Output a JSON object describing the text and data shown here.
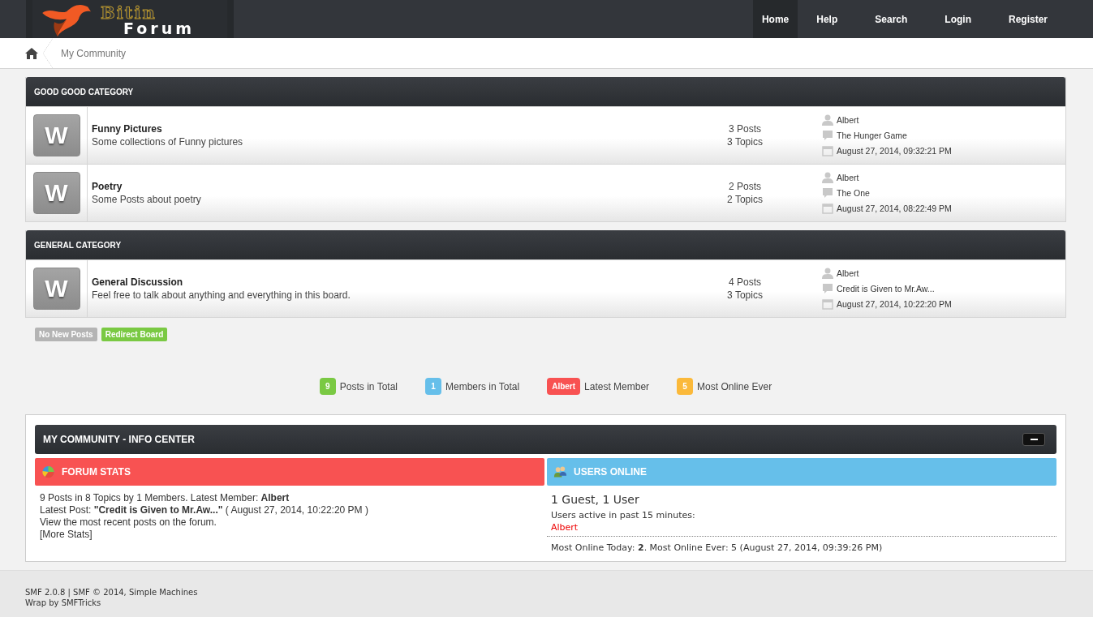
{
  "logo": {
    "word1": "Bitin",
    "word2": "Forum"
  },
  "nav": [
    {
      "label": "Home",
      "selected": true
    },
    {
      "label": "Help",
      "selected": false
    },
    {
      "label": "Search",
      "selected": false
    },
    {
      "label": "Login",
      "selected": false
    },
    {
      "label": "Register",
      "selected": false
    }
  ],
  "breadcrumb": [
    "My Community"
  ],
  "categories": [
    {
      "title": "GOOD GOOD CATEGORY",
      "boards": [
        {
          "icon_letter": "W",
          "name": "Funny Pictures",
          "description": "Some collections of Funny pictures",
          "posts": "3 Posts",
          "topics": "3 Topics",
          "last_user": "Albert",
          "last_topic": "The Hunger Game",
          "last_date": "August 27, 2014, 09:32:21 PM"
        },
        {
          "icon_letter": "W",
          "name": "Poetry",
          "description": "Some Posts about poetry",
          "posts": "2 Posts",
          "topics": "2 Topics",
          "last_user": "Albert",
          "last_topic": "The One",
          "last_date": "August 27, 2014, 08:22:49 PM"
        }
      ]
    },
    {
      "title": "GENERAL CATEGORY",
      "boards": [
        {
          "icon_letter": "W",
          "name": "General Discussion",
          "description": "Feel free to talk about anything and everything in this board.",
          "posts": "4 Posts",
          "topics": "3 Topics",
          "last_user": "Albert",
          "last_topic": "Credit is Given to Mr.Aw...",
          "last_date": "August 27, 2014, 10:22:20 PM"
        }
      ]
    }
  ],
  "legend": [
    {
      "label": "No New Posts",
      "color": "#b4b4b4"
    },
    {
      "label": "Redirect Board",
      "color": "#7ac943"
    }
  ],
  "totals": [
    {
      "badge": "9",
      "label": "Posts in Total",
      "color": "#7ac943"
    },
    {
      "badge": "1",
      "label": "Members in Total",
      "color": "#66bfea"
    },
    {
      "badge": "Albert",
      "label": "Latest Member",
      "color": "#f85252"
    },
    {
      "badge": "5",
      "label": "Most Online Ever",
      "color": "#fbb93a"
    }
  ],
  "info_center": {
    "title": "MY COMMUNITY - INFO CENTER",
    "forum_stats": {
      "title": "FORUM STATS",
      "lines": [
        "9 Posts in 8 Topics by 1 Members. Latest Member: **Albert**",
        "Latest Post: **\"Credit is Given to Mr.Aw...\"** ( August 27, 2014, 10:22:20 PM )",
        "View the most recent posts on the forum.",
        "[More Stats]"
      ]
    },
    "users_online": {
      "title": "USERS ONLINE",
      "summary": "1 Guest, 1 User",
      "active_label": "Users active in past 15 minutes:",
      "users": [
        "Albert"
      ],
      "most_online": "Most Online Today: **2**. Most Online Ever: 5 (August 27, 2014, 09:39:26 PM)"
    }
  },
  "footer": [
    "SMF 2.0.8 | SMF © 2014, Simple Machines",
    "Wrap by SMFTricks"
  ]
}
